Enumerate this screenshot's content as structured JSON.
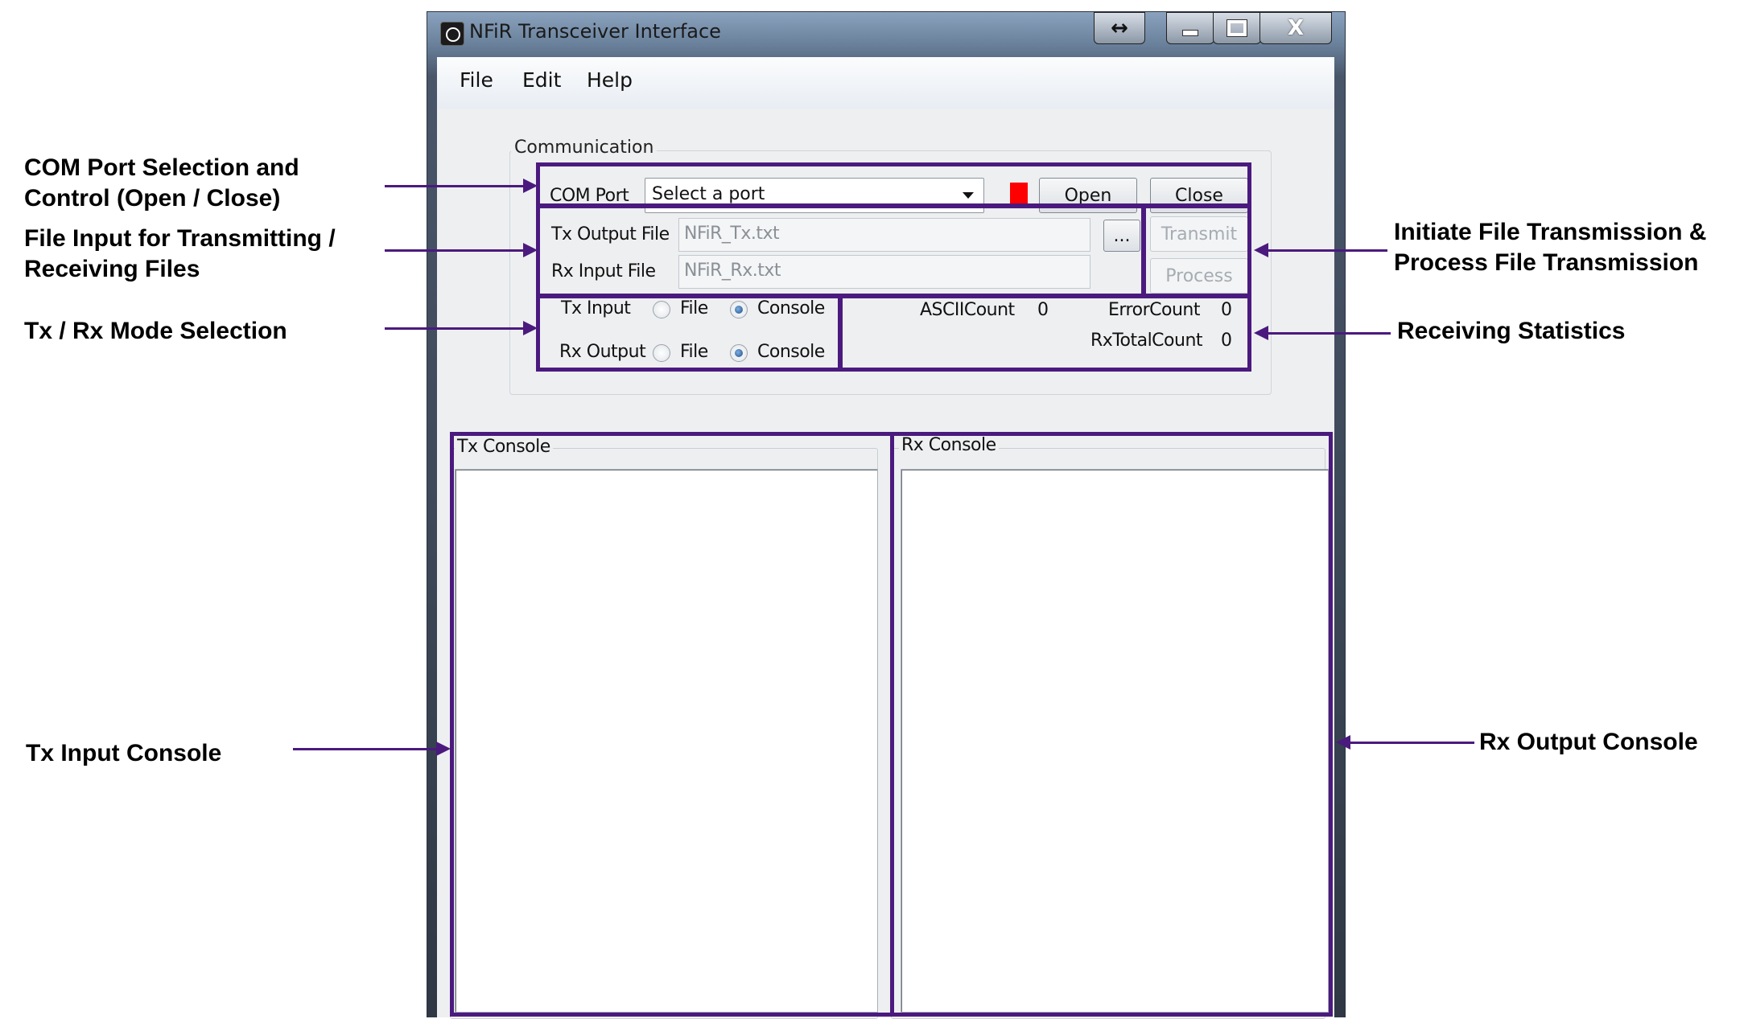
{
  "window": {
    "title": "NFiR Transceiver Interface",
    "buttons": {
      "restore": "↔",
      "minimize": "▁",
      "maximize": "☐",
      "close": "X"
    }
  },
  "menu": [
    "File",
    "Edit",
    "Help"
  ],
  "communication": {
    "legend": "Communication",
    "com_port_label": "COM Port",
    "port_select": "Select a port",
    "open_label": "Open",
    "close_label": "Close",
    "status_color": "#ff0000",
    "tx_file_label": "Tx Output File",
    "tx_file_value": "NFiR_Tx.txt",
    "rx_file_label": "Rx Input File",
    "rx_file_value": "NFiR_Rx.txt",
    "browse_label": "...",
    "transmit_label": "Transmit",
    "process_label": "Process",
    "tx_input_label": "Tx Input",
    "rx_output_label": "Rx Output",
    "file_option": "File",
    "console_option": "Console",
    "tx_input_mode": "Console",
    "rx_output_mode": "Console",
    "ascii_count_label": "ASCIICount",
    "ascii_count": "0",
    "error_count_label": "ErrorCount",
    "error_count": "0",
    "rx_total_label": "RxTotalCount",
    "rx_total": "0"
  },
  "consoles": {
    "tx_label": "Tx Console",
    "rx_label": "Rx Console"
  },
  "annotations": {
    "com_port_line1": "COM Port Selection and",
    "com_port_line2": "Control (Open / Close)",
    "file_input_line1": "File Input for Transmitting /",
    "file_input_line2": "Receiving Files",
    "mode": "Tx / Rx Mode Selection",
    "tx_console": "Tx Input Console",
    "initiate_line1": "Initiate File Transmission &",
    "initiate_line2": "Process File Transmission",
    "stats": "Receiving Statistics",
    "rx_console": "Rx Output Console"
  },
  "colors": {
    "highlight": "#4b1a7e"
  }
}
